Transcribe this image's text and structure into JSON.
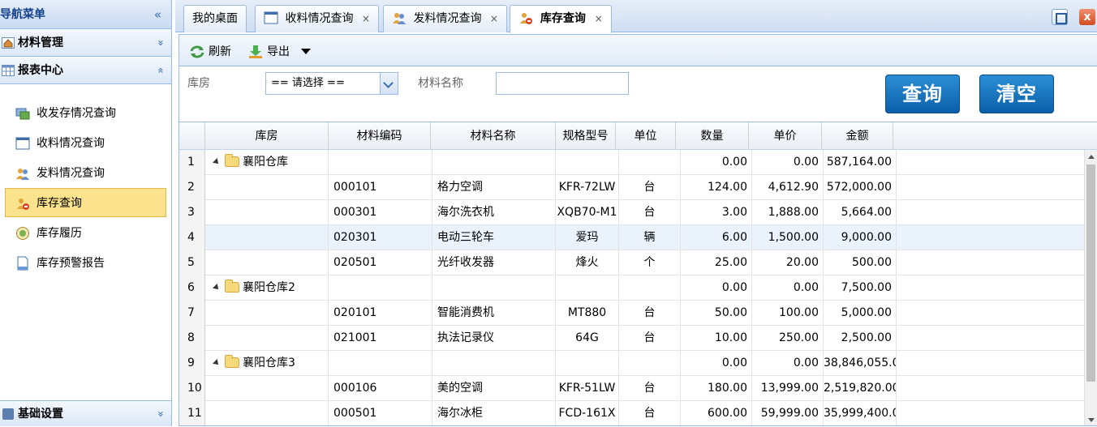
{
  "sidebar": {
    "title": "导航菜单",
    "collapse_glyph": "«",
    "sections": [
      {
        "label": "材料管理",
        "chevron": "»"
      },
      {
        "label": "报表中心",
        "chevron": "«"
      }
    ],
    "items": [
      {
        "label": "收发存情况查询",
        "icon": "inout-stock-icon"
      },
      {
        "label": "收料情况查询",
        "icon": "window-icon"
      },
      {
        "label": "发料情况查询",
        "icon": "users-icon"
      },
      {
        "label": "库存查询",
        "icon": "stock-query-icon",
        "active": true
      },
      {
        "label": "库存履历",
        "icon": "history-icon"
      },
      {
        "label": "库存预警报告",
        "icon": "document-icon"
      }
    ],
    "bottom_section": {
      "label": "基础设置",
      "chevron": "»"
    }
  },
  "tabs": [
    {
      "label": "我的桌面",
      "closable": false
    },
    {
      "label": "收料情况查询",
      "closable": true,
      "icon": "window-icon"
    },
    {
      "label": "发料情况查询",
      "closable": true,
      "icon": "users-icon"
    },
    {
      "label": "库存查询",
      "closable": true,
      "icon": "stock-query-icon",
      "active": true
    }
  ],
  "tab_close_glyph": "×",
  "window": {
    "close_glyph": "x"
  },
  "toolbar": {
    "refresh_label": "刷新",
    "export_label": "导出"
  },
  "filters": {
    "warehouse_label": "库房",
    "warehouse_value": "== 请选择 ==",
    "material_name_label": "材料名称",
    "material_name_value": "",
    "search_button": "查询",
    "clear_button": "清空"
  },
  "grid": {
    "columns": [
      "库房",
      "材料编码",
      "材料名称",
      "规格型号",
      "单位",
      "数量",
      "单价",
      "金额"
    ],
    "rows": [
      {
        "idx": "1",
        "group": true,
        "warehouse": "襄阳仓库",
        "code": "",
        "name": "",
        "spec": "",
        "unit": "",
        "qty": "0.00",
        "price": "0.00",
        "amount": "587,164.00"
      },
      {
        "idx": "2",
        "group": false,
        "warehouse": "",
        "code": "000101",
        "name": "格力空调",
        "spec": "KFR-72LW",
        "unit": "台",
        "qty": "124.00",
        "price": "4,612.90",
        "amount": "572,000.00"
      },
      {
        "idx": "3",
        "group": false,
        "warehouse": "",
        "code": "000301",
        "name": "海尔洗衣机",
        "spec": "XQB70-M1",
        "unit": "台",
        "qty": "3.00",
        "price": "1,888.00",
        "amount": "5,664.00"
      },
      {
        "idx": "4",
        "group": false,
        "warehouse": "",
        "code": "020301",
        "name": "电动三轮车",
        "spec": "爱玛",
        "unit": "辆",
        "qty": "6.00",
        "price": "1,500.00",
        "amount": "9,000.00",
        "highlight": true
      },
      {
        "idx": "5",
        "group": false,
        "warehouse": "",
        "code": "020501",
        "name": "光纤收发器",
        "spec": "烽火",
        "unit": "个",
        "qty": "25.00",
        "price": "20.00",
        "amount": "500.00"
      },
      {
        "idx": "6",
        "group": true,
        "warehouse": "襄阳仓库2",
        "code": "",
        "name": "",
        "spec": "",
        "unit": "",
        "qty": "0.00",
        "price": "0.00",
        "amount": "7,500.00"
      },
      {
        "idx": "7",
        "group": false,
        "warehouse": "",
        "code": "020101",
        "name": "智能消费机",
        "spec": "MT880",
        "unit": "台",
        "qty": "50.00",
        "price": "100.00",
        "amount": "5,000.00"
      },
      {
        "idx": "8",
        "group": false,
        "warehouse": "",
        "code": "021001",
        "name": "执法记录仪",
        "spec": "64G",
        "unit": "台",
        "qty": "10.00",
        "price": "250.00",
        "amount": "2,500.00"
      },
      {
        "idx": "9",
        "group": true,
        "warehouse": "襄阳仓库3",
        "code": "",
        "name": "",
        "spec": "",
        "unit": "",
        "qty": "0.00",
        "price": "0.00",
        "amount": "38,846,055.0"
      },
      {
        "idx": "10",
        "group": false,
        "warehouse": "",
        "code": "000106",
        "name": "美的空调",
        "spec": "KFR-51LW",
        "unit": "台",
        "qty": "180.00",
        "price": "13,999.00",
        "amount": "2,519,820.00"
      },
      {
        "idx": "11",
        "group": false,
        "warehouse": "",
        "code": "000501",
        "name": "海尔冰柜",
        "spec": "FCD-161X",
        "unit": "台",
        "qty": "600.00",
        "price": "59,999.00",
        "amount": "35,999,400.0"
      }
    ]
  }
}
